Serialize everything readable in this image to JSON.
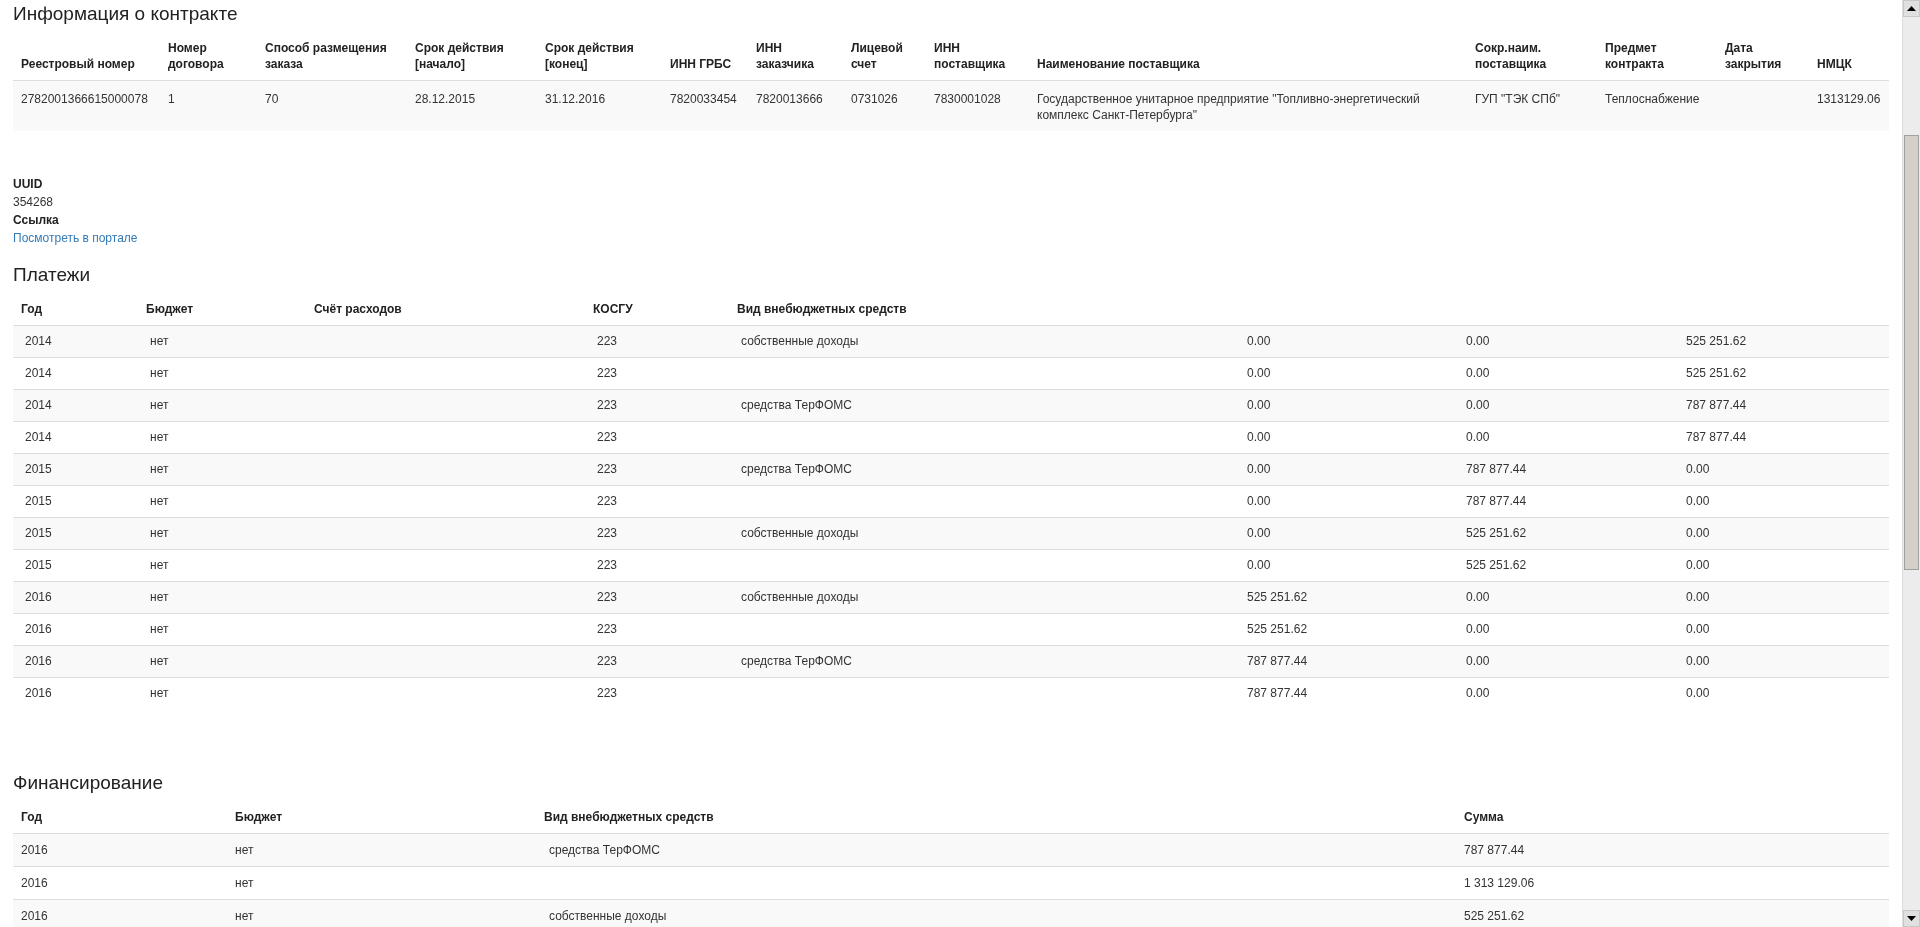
{
  "contract": {
    "title": "Информация о контракте",
    "columns": [
      "Реестровый номер",
      "Номер договора",
      "Способ размещения заказа",
      "Срок действия [начало]",
      "Срок действия [конец]",
      "ИНН ГРБС",
      "ИНН заказчика",
      "Лицевой счет",
      "ИНН поставщика",
      "Наименование поставщика",
      "Сокр.наим. поставщика",
      "Предмет контракта",
      "Дата закрытия",
      "НМЦК"
    ],
    "rows": [
      {
        "registry_number": "2782001366615000078",
        "contract_number": "1",
        "placement_method": "70",
        "start": "28.12.2015",
        "end": "31.12.2016",
        "inn_grbs": "7820033454",
        "inn_customer": "7820013666",
        "account": "0731026",
        "inn_supplier": "7830001028",
        "supplier_name": "Государственное унитарное предприятие \"Топливно-энергетический комплекс Санкт-Петербурга\"",
        "supplier_short": "ГУП \"ТЭК СПб\"",
        "subject": "Теплоснабжение",
        "nmck": "1313129.06"
      }
    ]
  },
  "details": [
    {
      "label": "UUID",
      "value": "354268",
      "kind": "text"
    },
    {
      "label": "Ссылка",
      "value": "Посмотреть в портале",
      "kind": "link"
    }
  ],
  "payments": {
    "title": "Платежи",
    "columns": [
      "Год",
      "Бюджет",
      "Счёт расходов",
      "КОСГУ",
      "Вид внебюджетных средств"
    ],
    "rows": [
      {
        "year": "2014",
        "budget": "нет",
        "kosgu": "223",
        "fund_type": "собственные доходы",
        "column_6": "0.00",
        "column_7": "0.00",
        "column_8": "525 251.62"
      },
      {
        "year": "2014",
        "budget": "нет",
        "kosgu": "223",
        "column_6": "0.00",
        "column_7": "0.00",
        "column_8": "525 251.62"
      },
      {
        "year": "2014",
        "budget": "нет",
        "kosgu": "223",
        "fund_type": "средства ТерФОМС",
        "column_6": "0.00",
        "column_7": "0.00",
        "column_8": "787 877.44"
      },
      {
        "year": "2014",
        "budget": "нет",
        "kosgu": "223",
        "column_6": "0.00",
        "column_7": "0.00",
        "column_8": "787 877.44"
      },
      {
        "year": "2015",
        "budget": "нет",
        "kosgu": "223",
        "fund_type": "средства ТерФОМС",
        "column_6": "0.00",
        "column_7": "787 877.44",
        "column_8": "0.00"
      },
      {
        "year": "2015",
        "budget": "нет",
        "kosgu": "223",
        "column_6": "0.00",
        "column_7": "787 877.44",
        "column_8": "0.00"
      },
      {
        "year": "2015",
        "budget": "нет",
        "kosgu": "223",
        "fund_type": "собственные доходы",
        "column_6": "0.00",
        "column_7": "525 251.62",
        "column_8": "0.00"
      },
      {
        "year": "2015",
        "budget": "нет",
        "kosgu": "223",
        "column_6": "0.00",
        "column_7": "525 251.62",
        "column_8": "0.00"
      },
      {
        "year": "2016",
        "budget": "нет",
        "kosgu": "223",
        "fund_type": "собственные доходы",
        "column_6": "525 251.62",
        "column_7": "0.00",
        "column_8": "0.00"
      },
      {
        "year": "2016",
        "budget": "нет",
        "kosgu": "223",
        "column_6": "525 251.62",
        "column_7": "0.00",
        "column_8": "0.00"
      },
      {
        "year": "2016",
        "budget": "нет",
        "kosgu": "223",
        "fund_type": "средства ТерФОМС",
        "column_6": "787 877.44",
        "column_7": "0.00",
        "column_8": "0.00"
      },
      {
        "year": "2016",
        "budget": "нет",
        "kosgu": "223",
        "column_6": "787 877.44",
        "column_7": "0.00",
        "column_8": "0.00"
      }
    ]
  },
  "financing": {
    "title": "Финансирование",
    "columns": [
      "Год",
      "Бюджет",
      "Вид внебюджетных средств",
      "Сумма"
    ],
    "rows": [
      {
        "year": "2016",
        "budget": "нет",
        "fund_type": "средства ТерФОМС",
        "sum": "787 877.44"
      },
      {
        "year": "2016",
        "budget": "нет",
        "sum": "1 313 129.06"
      },
      {
        "year": "2016",
        "budget": "нет",
        "fund_type": "собственные доходы",
        "sum": "525 251.62"
      }
    ]
  }
}
